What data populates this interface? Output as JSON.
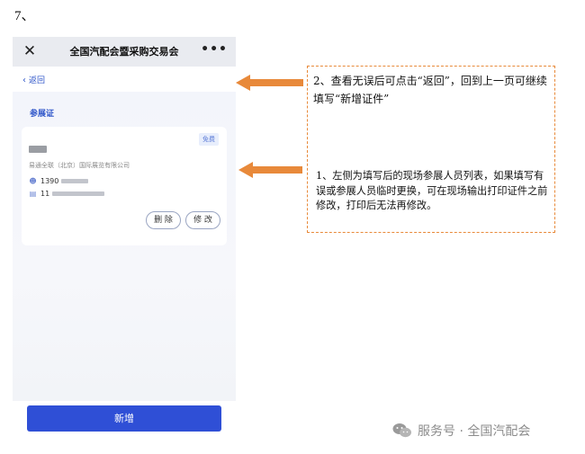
{
  "step_number": "7、",
  "phone": {
    "header": {
      "close_icon": "close-icon",
      "title": "全国汽配会暨采购交易会",
      "more_icon": "more-icon",
      "more_glyph": "•••"
    },
    "back_label": "返回",
    "section_title": "参展证",
    "card": {
      "badge": "免费",
      "company": "易通全联（北京）国际展览有限公司",
      "phone_prefix": "1390",
      "id_prefix": "11",
      "delete_label": "删 除",
      "edit_label": "修 改"
    },
    "add_button_label": "新增"
  },
  "annotations": {
    "note_1": "2、查看无误后可点击“返回”，回到上一页可继续填写“新增证件”",
    "note_2": "1、左侧为填写后的现场参展人员列表，如果填写有误或参展人员临时更换，可在现场输出打印证件之前修改，打印后无法再修改。",
    "arrow_color": "#e8893a",
    "box_border_color": "#e88a3a"
  },
  "watermark": {
    "text": "服务号 · 全国汽配会",
    "icon": "wechat-icon"
  },
  "colors": {
    "accent": "#2e55c9",
    "primary_button": "#2f4fd6"
  }
}
